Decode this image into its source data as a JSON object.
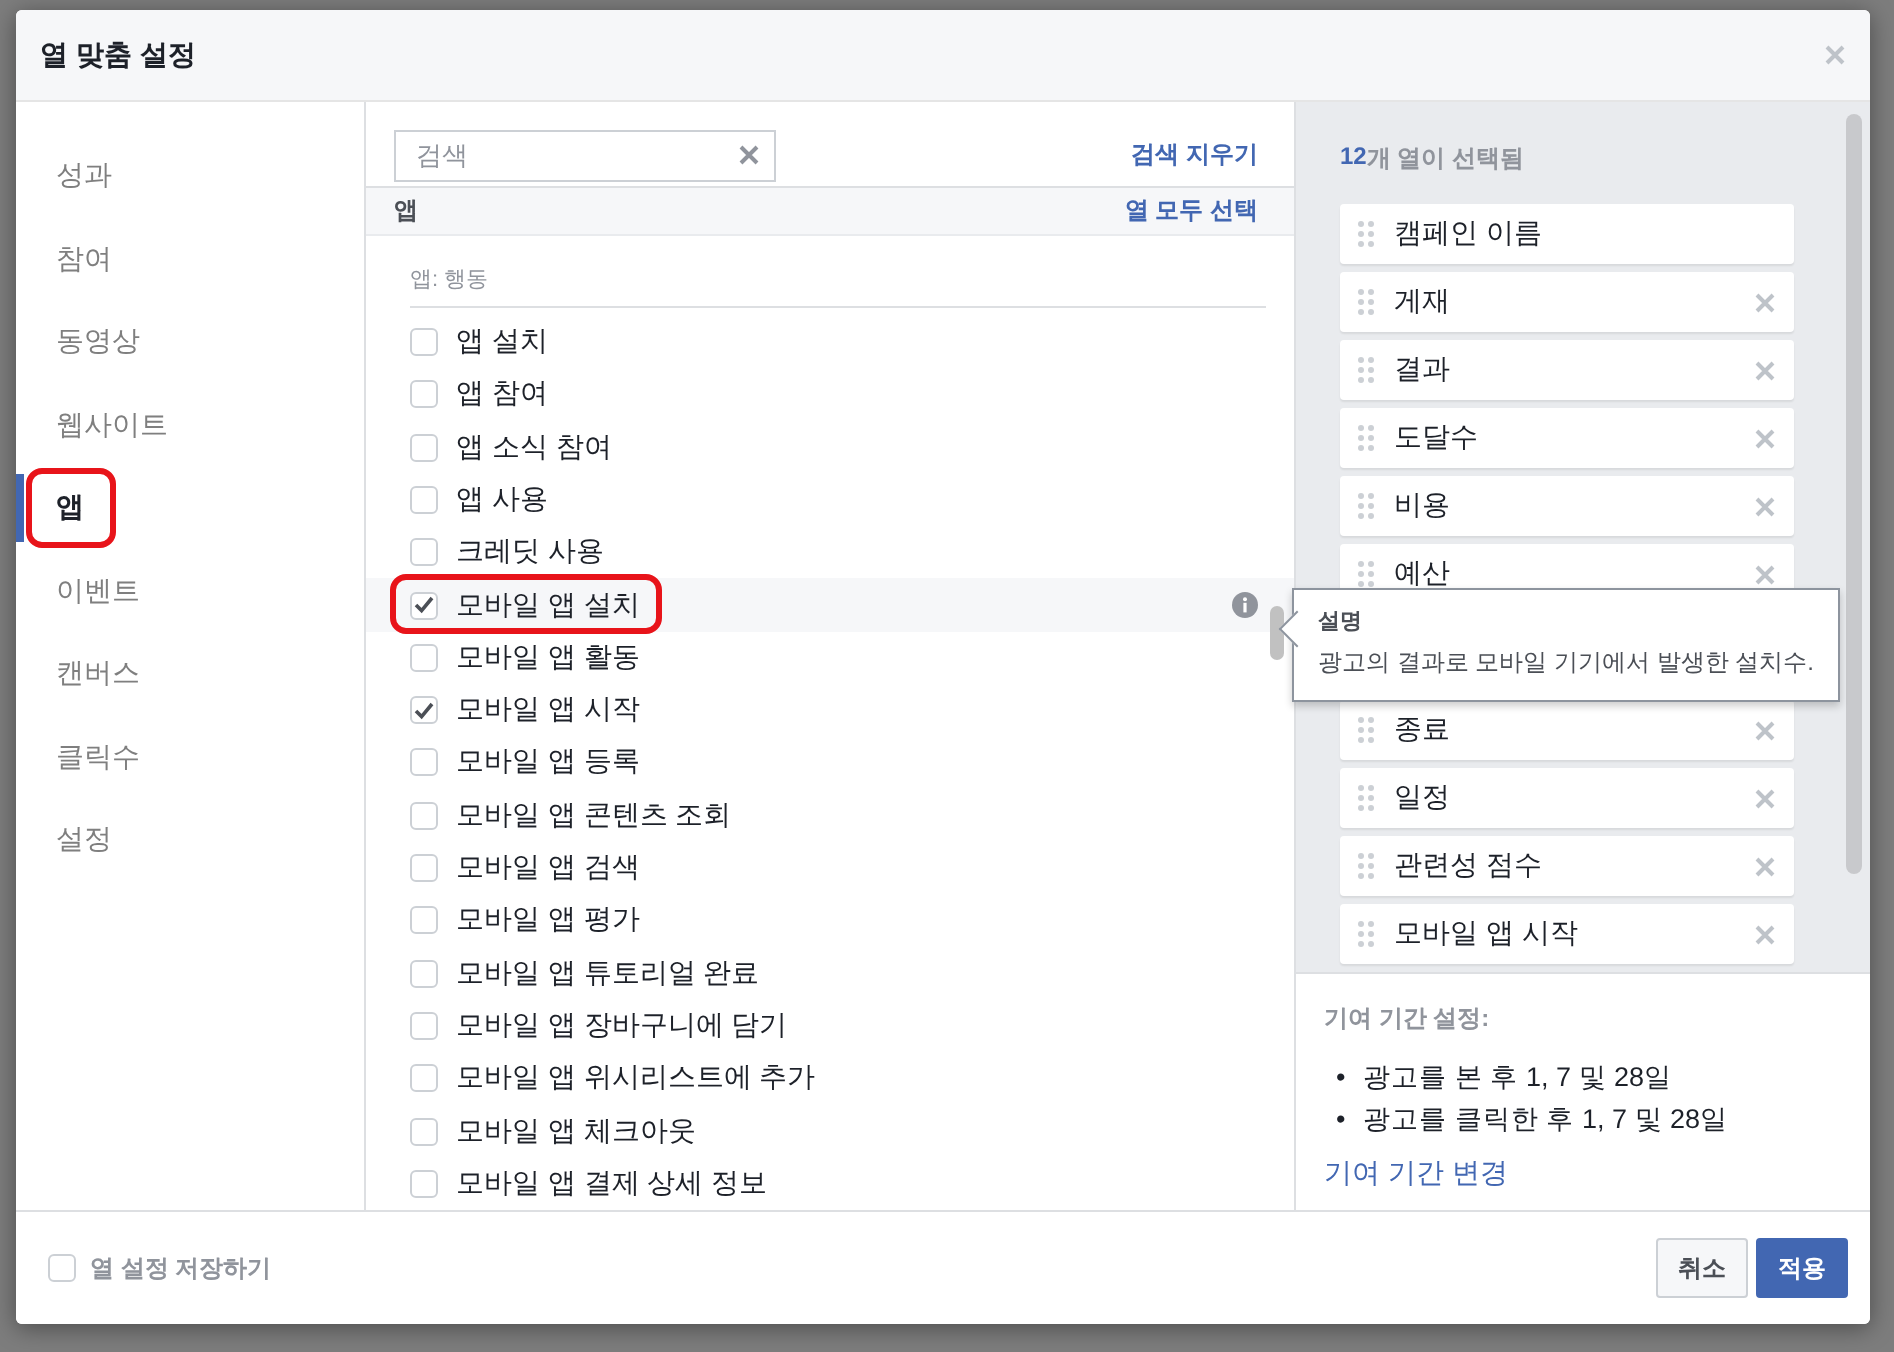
{
  "window": {
    "title": "열 맞춤 설정"
  },
  "sidebar": {
    "items": [
      {
        "label": "성과",
        "selected": false,
        "annotated": false
      },
      {
        "label": "참여",
        "selected": false,
        "annotated": false
      },
      {
        "label": "동영상",
        "selected": false,
        "annotated": false
      },
      {
        "label": "웹사이트",
        "selected": false,
        "annotated": false
      },
      {
        "label": "앱",
        "selected": true,
        "annotated": true
      },
      {
        "label": "이벤트",
        "selected": false,
        "annotated": false
      },
      {
        "label": "캔버스",
        "selected": false,
        "annotated": false
      },
      {
        "label": "클릭수",
        "selected": false,
        "annotated": false
      },
      {
        "label": "설정",
        "selected": false,
        "annotated": false
      }
    ]
  },
  "search": {
    "placeholder": "검색",
    "clear_link": "검색 지우기"
  },
  "section": {
    "title": "앱",
    "select_all_link": "열 모두 선택",
    "subtitle": "앱: 행동"
  },
  "options": [
    {
      "label": "앱 설치",
      "checked": false,
      "hovered": false,
      "annotated": false
    },
    {
      "label": "앱 참여",
      "checked": false,
      "hovered": false,
      "annotated": false
    },
    {
      "label": "앱 소식 참여",
      "checked": false,
      "hovered": false,
      "annotated": false
    },
    {
      "label": "앱 사용",
      "checked": false,
      "hovered": false,
      "annotated": false
    },
    {
      "label": "크레딧 사용",
      "checked": false,
      "hovered": false,
      "annotated": false
    },
    {
      "label": "모바일 앱 설치",
      "checked": true,
      "hovered": true,
      "annotated": true
    },
    {
      "label": "모바일 앱 활동",
      "checked": false,
      "hovered": false,
      "annotated": false
    },
    {
      "label": "모바일 앱 시작",
      "checked": true,
      "hovered": false,
      "annotated": false
    },
    {
      "label": "모바일 앱 등록",
      "checked": false,
      "hovered": false,
      "annotated": false
    },
    {
      "label": "모바일 앱 콘텐츠 조회",
      "checked": false,
      "hovered": false,
      "annotated": false
    },
    {
      "label": "모바일 앱 검색",
      "checked": false,
      "hovered": false,
      "annotated": false
    },
    {
      "label": "모바일 앱 평가",
      "checked": false,
      "hovered": false,
      "annotated": false
    },
    {
      "label": "모바일 앱 튜토리얼 완료",
      "checked": false,
      "hovered": false,
      "annotated": false
    },
    {
      "label": "모바일 앱 장바구니에 담기",
      "checked": false,
      "hovered": false,
      "annotated": false
    },
    {
      "label": "모바일 앱 위시리스트에 추가",
      "checked": false,
      "hovered": false,
      "annotated": false
    },
    {
      "label": "모바일 앱 체크아웃",
      "checked": false,
      "hovered": false,
      "annotated": false
    },
    {
      "label": "모바일 앱 결제 상세 정보",
      "checked": false,
      "hovered": false,
      "annotated": false
    }
  ],
  "tooltip": {
    "title": "설명",
    "text": "광고의 결과로 모바일 기기에서 발생한 설치수."
  },
  "selected_columns": {
    "count": "12",
    "label": "개 열이 선택됨",
    "items": [
      {
        "label": "캠페인 이름",
        "removable": false
      },
      {
        "label": "게재",
        "removable": true
      },
      {
        "label": "결과",
        "removable": true
      },
      {
        "label": "도달수",
        "removable": true
      },
      {
        "label": "비용",
        "removable": true
      },
      {
        "label": "예산",
        "removable": true
      },
      {
        "label": "종료",
        "removable": true
      },
      {
        "label": "일정",
        "removable": true
      },
      {
        "label": "관련성 점수",
        "removable": true
      },
      {
        "label": "모바일 앱 시작",
        "removable": true
      }
    ]
  },
  "attribution": {
    "title": "기여 기간 설정:",
    "bullets": [
      {
        "marker": "•",
        "text": "광고를 본 후 1, 7 및 28일"
      },
      {
        "marker": "•",
        "text": "광고를 클릭한 후 1, 7 및 28일"
      }
    ],
    "link": "기여 기간 변경"
  },
  "footer": {
    "save_checkbox": {
      "label": "열 설정 저장하기",
      "checked": false
    },
    "buttons": [
      {
        "label": "취소",
        "kind": "secondary"
      },
      {
        "label": "적용",
        "kind": "primary"
      }
    ]
  }
}
